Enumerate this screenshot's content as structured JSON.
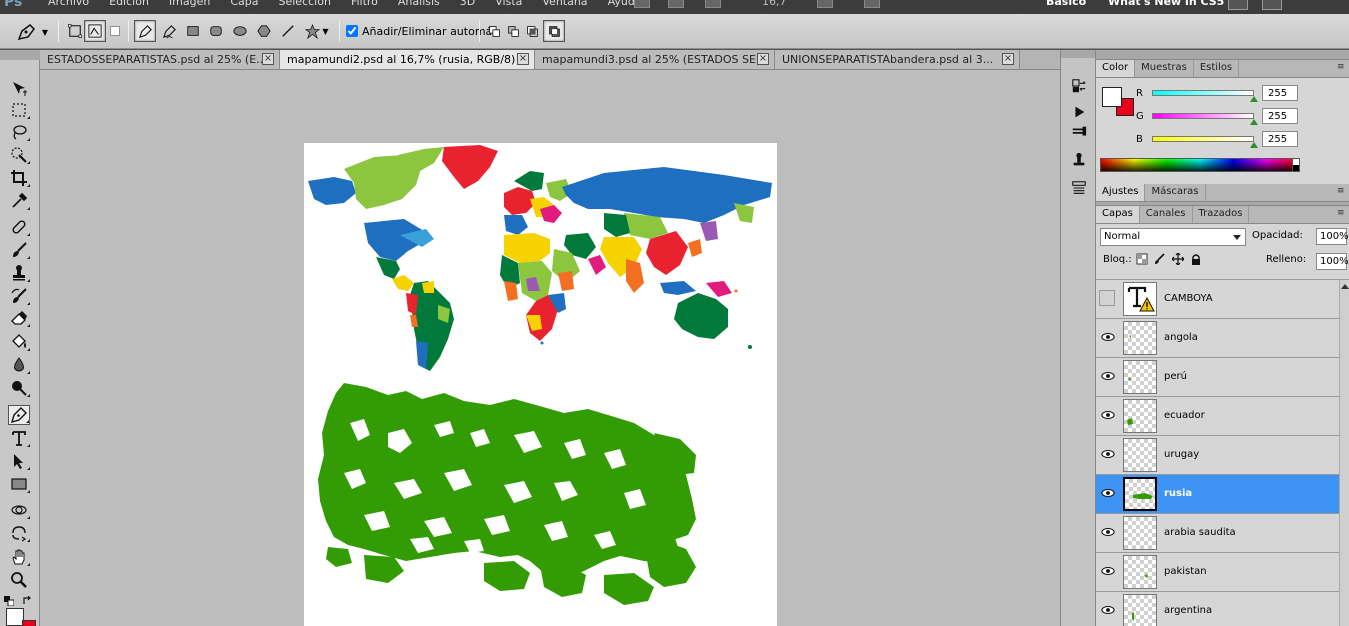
{
  "menubar": {
    "logo": "Ps",
    "items": [
      "Archivo",
      "Edición",
      "Imagen",
      "Capa",
      "Selección",
      "Filtro",
      "Análisis",
      "3D",
      "Vista",
      "Ventana",
      "Ayuda"
    ],
    "zoom": "16,7",
    "workspace_basic": "Básico",
    "workspace_cs5": "What's New in CS5"
  },
  "options": {
    "auto_add_label": "Añadir/Eliminar automát."
  },
  "tabs": [
    {
      "label": "ESTADOSSEPARATISTAS.psd al 25% (E...",
      "close": "×"
    },
    {
      "label": "mapamundi2.psd al 16,7% (rusia, RGB/8) *",
      "close": "×"
    },
    {
      "label": "mapamundi3.psd al 25% (ESTADOS SE...",
      "close": "×"
    },
    {
      "label": "UNIONSEPARATISTAbandera.psd al 3...",
      "close": "×"
    }
  ],
  "color_panel": {
    "tabs": [
      "Color",
      "Muestras",
      "Estilos"
    ],
    "rows": [
      {
        "label": "R",
        "value": "255"
      },
      {
        "label": "G",
        "value": "255"
      },
      {
        "label": "B",
        "value": "255"
      }
    ],
    "foreground": "#ffffff",
    "background": "#e8001c"
  },
  "adjust_panel": {
    "tabs": [
      "Ajustes",
      "Máscaras"
    ]
  },
  "layers_panel": {
    "tabs": [
      "Capas",
      "Canales",
      "Trazados"
    ],
    "blend_mode": "Normal",
    "opacity_label": "Opacidad:",
    "opacity": "100%",
    "lock_label": "Bloq.:",
    "fill_label": "Relleno:",
    "fill": "100%",
    "layers": [
      {
        "name": "CAMBOYA",
        "visible": false,
        "type": "text",
        "selected": false
      },
      {
        "name": "angola",
        "visible": true,
        "type": "pixel",
        "selected": false
      },
      {
        "name": "perú",
        "visible": true,
        "type": "pixel",
        "selected": false
      },
      {
        "name": "ecuador",
        "visible": true,
        "type": "pixel",
        "selected": false
      },
      {
        "name": "urugay",
        "visible": true,
        "type": "pixel",
        "selected": false
      },
      {
        "name": "rusia",
        "visible": true,
        "type": "pixel",
        "selected": true
      },
      {
        "name": "arabia saudita",
        "visible": true,
        "type": "pixel",
        "selected": false
      },
      {
        "name": "pakistan",
        "visible": true,
        "type": "pixel",
        "selected": false
      },
      {
        "name": "argentina",
        "visible": true,
        "type": "pixel",
        "selected": false
      }
    ]
  },
  "colors": {
    "selection": "#3d94f4",
    "russia_green": "#339c05",
    "greenland_red": "#e8222e",
    "russia_map_blue": "#1f6fc1"
  }
}
